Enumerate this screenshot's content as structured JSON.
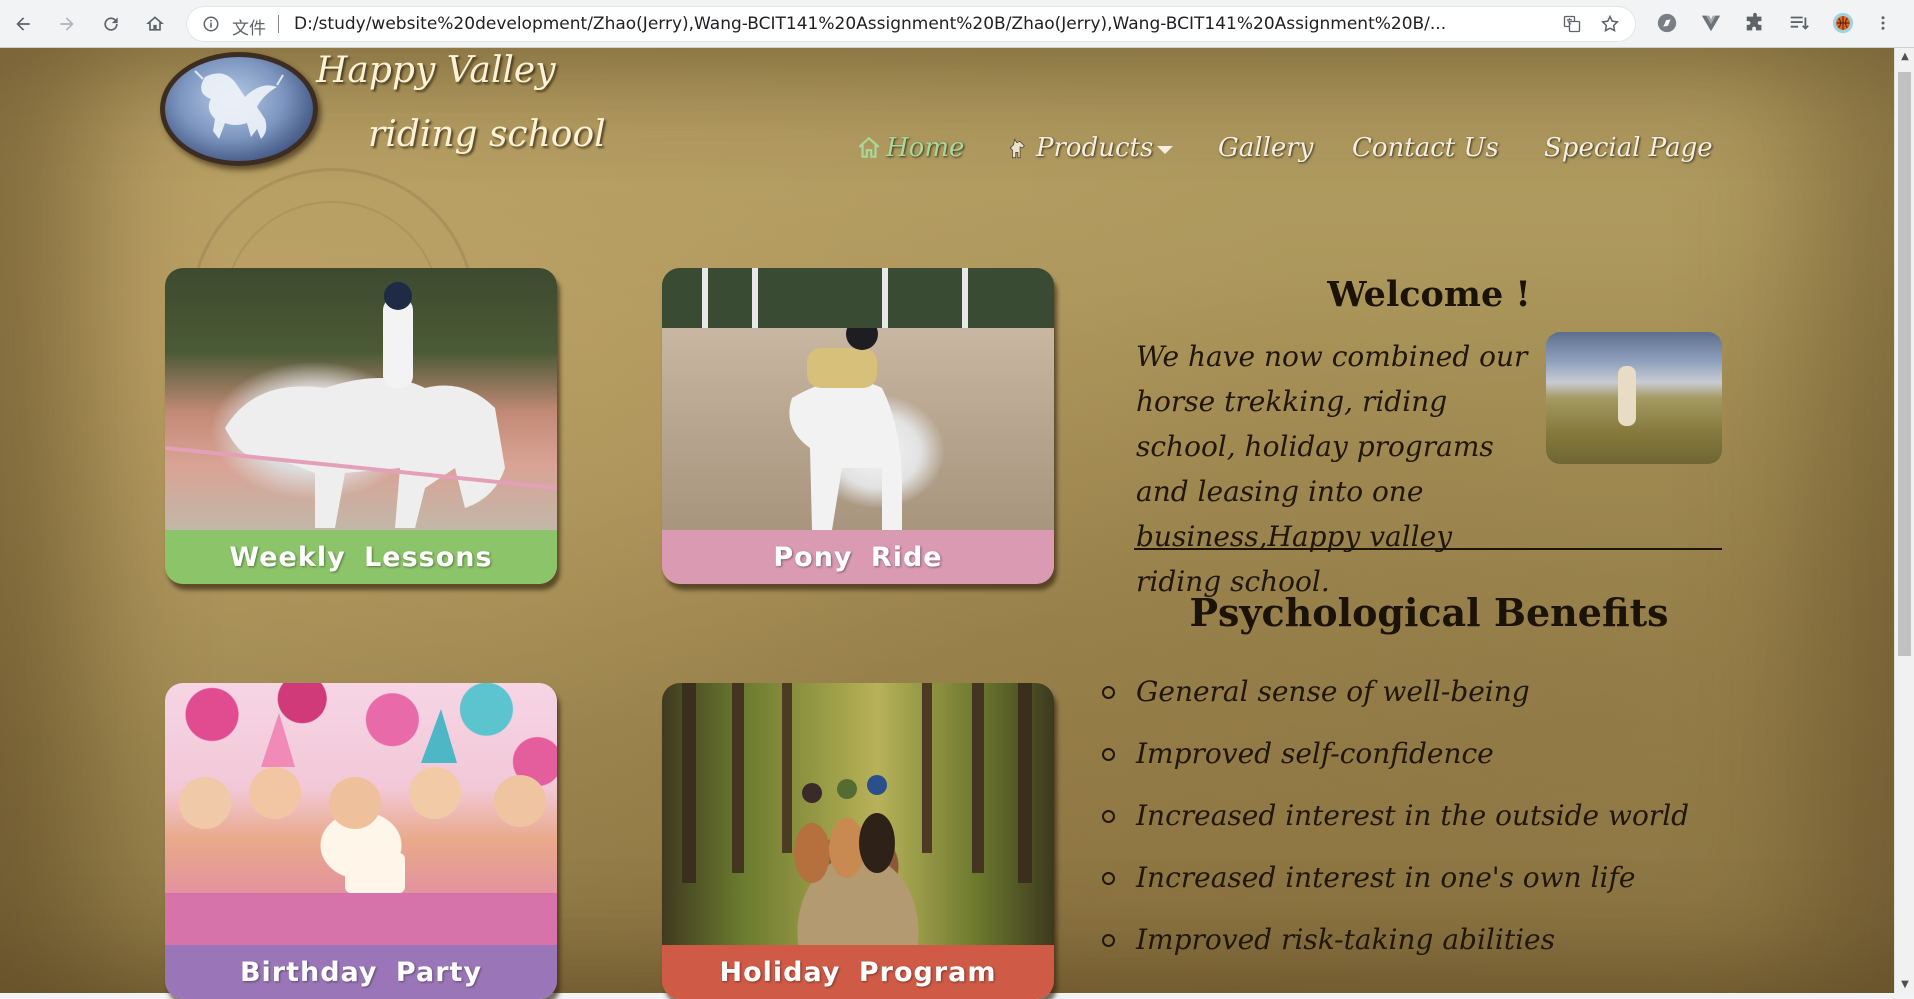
{
  "browser": {
    "scheme_label": "文件",
    "url": "D:/study/website%20development/Zhao(Jerry),Wang-BCIT141%20Assignment%20B/Zhao(Jerry),Wang-BCIT141%20Assignment%20B/..."
  },
  "site": {
    "brand_line1": "Happy Valley",
    "brand_line2": "riding school"
  },
  "nav": {
    "home": "Home",
    "products": "Products",
    "gallery": "Gallery",
    "contact": "Contact Us",
    "special": "Special Page",
    "active_color": "#a8d89a"
  },
  "cards": [
    {
      "label": "Weekly Lessons",
      "color": "#8cc46a"
    },
    {
      "label": "Pony Ride",
      "color": "#d99ab2"
    },
    {
      "label": "Birthday Party",
      "color": "#9a76b8"
    },
    {
      "label": "Holiday Program",
      "color": "#cf5a46"
    }
  ],
  "welcome": {
    "title": "Welcome !",
    "text": "We have now combined our horse trekking, riding school, holiday programs and leasing into one business,Happy valley riding school."
  },
  "benefits": {
    "title": "Psychological Benefits",
    "items": [
      "General sense of well-being",
      "Improved self-confidence",
      "Increased interest in the outside world",
      "Increased interest in one's own life",
      "Improved risk-taking abilities"
    ]
  }
}
